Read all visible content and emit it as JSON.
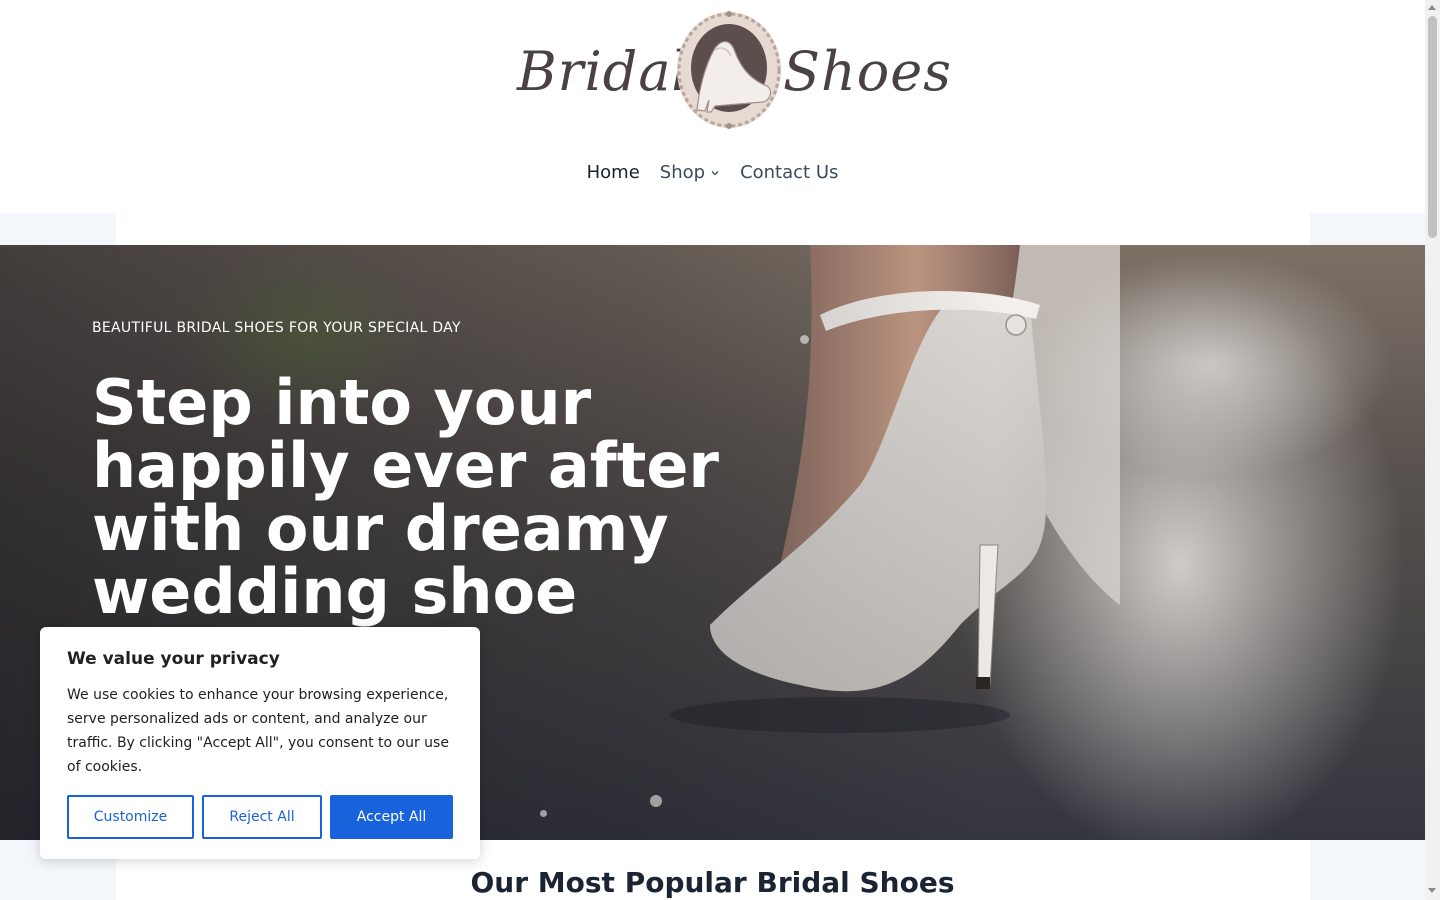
{
  "header": {
    "logo": {
      "text_left": "Bridal",
      "text_right": "Shoes",
      "icon": "high-heel-medallion-icon"
    },
    "nav": [
      {
        "label": "Home",
        "active": true
      },
      {
        "label": "Shop",
        "has_dropdown": true,
        "icon": "chevron-down-icon"
      },
      {
        "label": "Contact Us"
      }
    ]
  },
  "hero": {
    "kicker": "BEAUTIFUL BRIDAL SHOES FOR YOUR SPECIAL DAY",
    "title": "Step into your happily ever after with our dreamy wedding shoe collection."
  },
  "section": {
    "title": "Our Most Popular Bridal Shoes"
  },
  "cookie_banner": {
    "title": "We value your privacy",
    "text": "We use cookies to enhance your browsing experience, serve personalized ads or content, and analyze our traffic. By clicking \"Accept All\", you consent to our use of cookies.",
    "customize_label": "Customize",
    "reject_label": "Reject All",
    "accept_label": "Accept All",
    "accent_color": "#1863dc"
  }
}
